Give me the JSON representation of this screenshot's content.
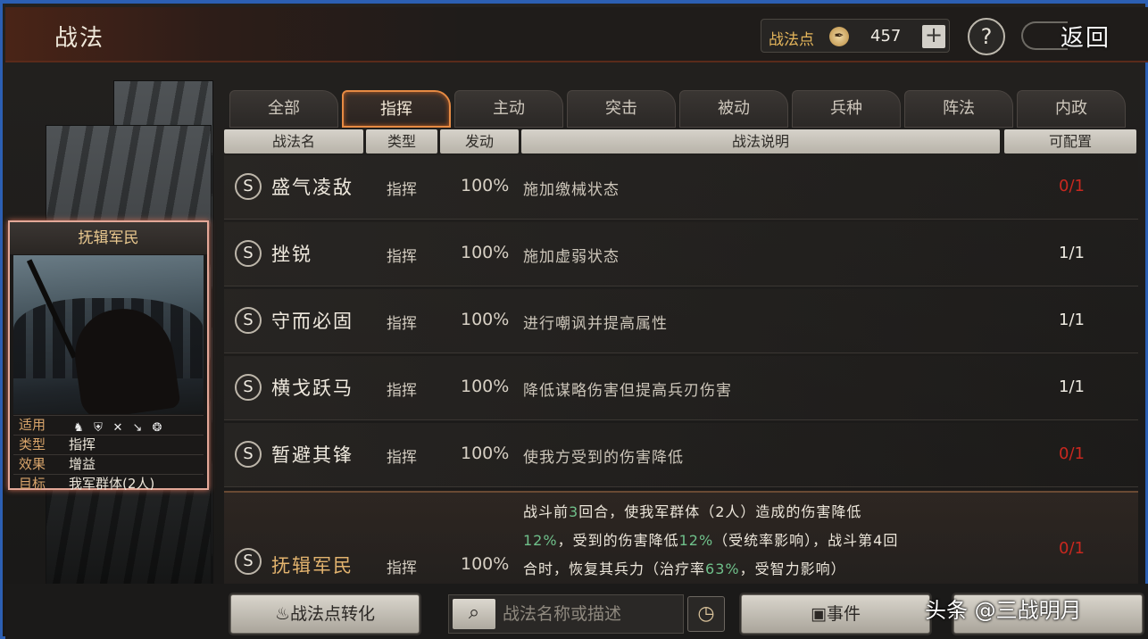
{
  "header": {
    "title": "战法",
    "points_label": "战法点",
    "points_value": "457",
    "plus_label": "+",
    "help_label": "?",
    "back_label": "返回"
  },
  "card": {
    "title": "抚辑军民",
    "rows": [
      {
        "key": "适用",
        "value": ""
      },
      {
        "key": "类型",
        "value": "指挥"
      },
      {
        "key": "效果",
        "value": "增益"
      },
      {
        "key": "目标",
        "value": "我军群体(2人)"
      }
    ],
    "unit_icons": [
      "cavalry-icon",
      "shield-icon",
      "bow-icon",
      "spear-icon",
      "siege-icon"
    ]
  },
  "tabs": [
    "全部",
    "指挥",
    "主动",
    "突击",
    "被动",
    "兵种",
    "阵法",
    "内政"
  ],
  "active_tab": "指挥",
  "columns": [
    "战法名",
    "类型",
    "发动",
    "战法说明",
    "可配置"
  ],
  "rows": [
    {
      "grade": "S",
      "name": "盛气凌敌",
      "type": "指挥",
      "rate": "100%",
      "desc": "施加缴械状态",
      "count": "0/1",
      "count_red": true
    },
    {
      "grade": "S",
      "name": "挫锐",
      "type": "指挥",
      "rate": "100%",
      "desc": "施加虚弱状态",
      "count": "1/1",
      "count_red": false
    },
    {
      "grade": "S",
      "name": "守而必固",
      "type": "指挥",
      "rate": "100%",
      "desc": "进行嘲讽并提高属性",
      "count": "1/1",
      "count_red": false
    },
    {
      "grade": "S",
      "name": "横戈跃马",
      "type": "指挥",
      "rate": "100%",
      "desc": "降低谋略伤害但提高兵刃伤害",
      "count": "1/1",
      "count_red": false
    },
    {
      "grade": "S",
      "name": "暂避其锋",
      "type": "指挥",
      "rate": "100%",
      "desc": "使我方受到的伤害降低",
      "count": "0/1",
      "count_red": true
    }
  ],
  "expanded_row": {
    "grade": "S",
    "name": "抚辑军民",
    "type": "指挥",
    "rate": "100%",
    "count": "0/1",
    "desc_parts": {
      "a": "战斗前",
      "b": "3",
      "c": "回合，使我军群体（2人）造成的伤害降低",
      "d": "12%",
      "e": "，受到的伤害降低",
      "f": "12%",
      "g": "（受统率影响），战斗第4回",
      "h": "合时，恢复其兵力（治疗率",
      "i": "63%",
      "j": "，受智力影响）"
    }
  },
  "bottom": {
    "convert_label": "战法点转化",
    "search_placeholder": "战法名称或描述",
    "event_label": "事件",
    "watermark": "头条 @三战明月"
  },
  "colors": {
    "accent_orange": "#e68a43",
    "count_red": "#c9281f",
    "highlight_green": "#6fc08a",
    "gold_text": "#e5b65b"
  }
}
